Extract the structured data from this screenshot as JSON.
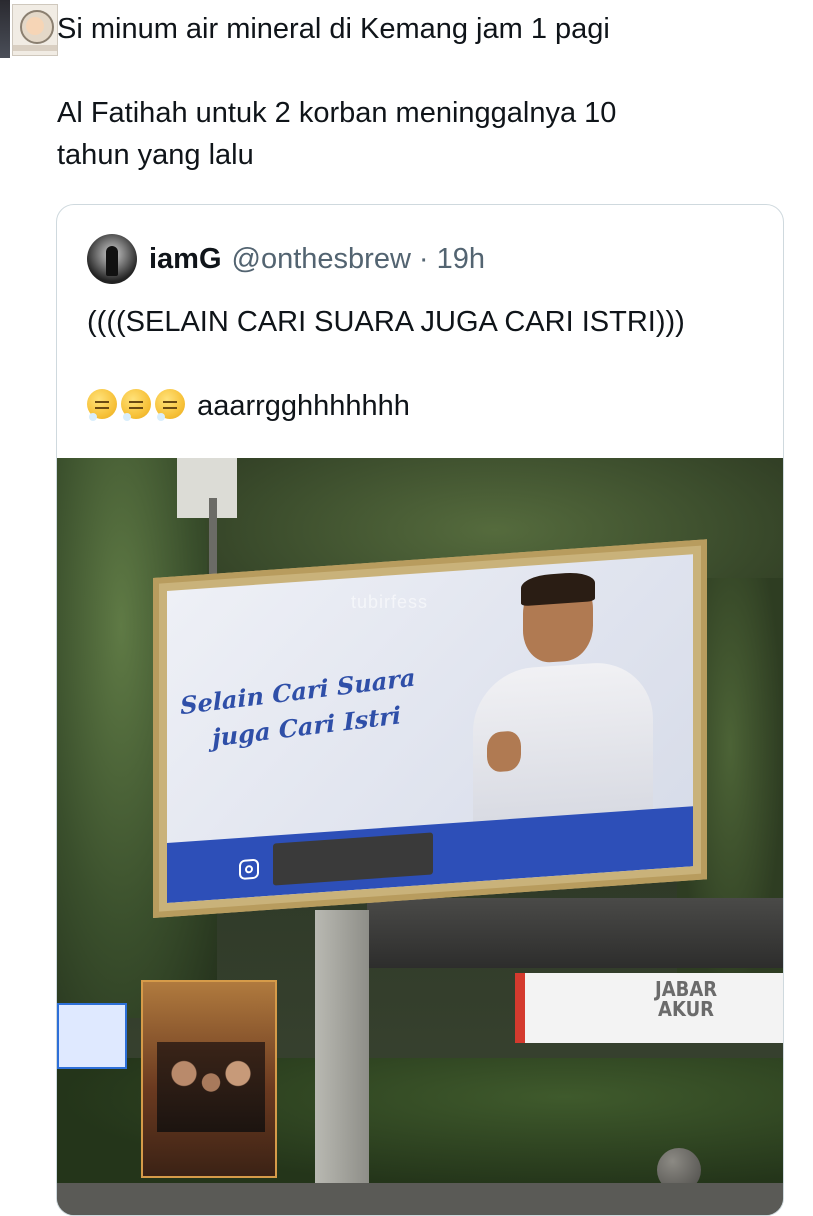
{
  "tweet": {
    "line1": "Si minum air mineral di Kemang jam 1 pagi",
    "line2": "Al Fatihah untuk 2 korban meninggalnya 10\ntahun yang lalu"
  },
  "quote": {
    "display_name": "iamG",
    "handle": "@onthesbrew",
    "time": "· 19h",
    "text_line1": "((((SELAIN CARI SUARA JUGA CARI ISTRI)))",
    "text_line2": "aaarrgghhhhhhh",
    "emoji_count": 3
  },
  "photo": {
    "watermark": "tubirfess",
    "billboard_line1": "Selain Cari Suara",
    "billboard_line2": "juga Cari Istri",
    "banner_text_line1": "JABAR",
    "banner_text_line2": "AKUR"
  }
}
